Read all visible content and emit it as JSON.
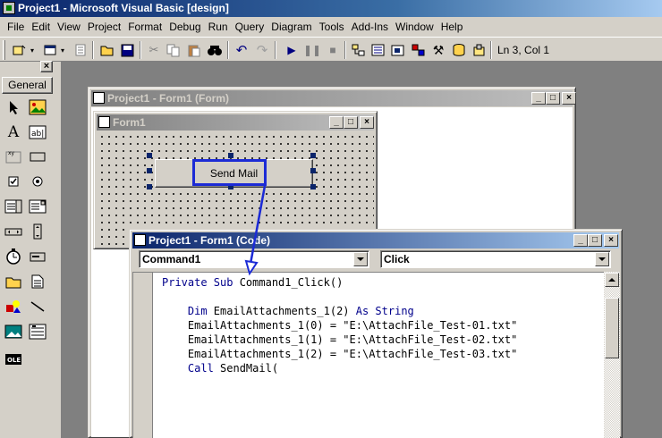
{
  "app": {
    "title": "Project1 - Microsoft Visual Basic [design]"
  },
  "menu": [
    {
      "label": "File"
    },
    {
      "label": "Edit"
    },
    {
      "label": "View"
    },
    {
      "label": "Project"
    },
    {
      "label": "Format"
    },
    {
      "label": "Debug"
    },
    {
      "label": "Run"
    },
    {
      "label": "Query"
    },
    {
      "label": "Diagram"
    },
    {
      "label": "Tools"
    },
    {
      "label": "Add-Ins"
    },
    {
      "label": "Window"
    },
    {
      "label": "Help"
    }
  ],
  "toolbar": {
    "cursor_position": "Ln 3, Col 1"
  },
  "toolbox": {
    "tab_label": "General",
    "close_label": "×"
  },
  "windows": {
    "form_designer_title": "Project1 - Form1 (Form)",
    "form_title": "Form1",
    "code_title": "Project1 - Form1 (Code)"
  },
  "form": {
    "button_caption": "Send Mail"
  },
  "code": {
    "object_combo": "Command1",
    "procedure_combo": "Click",
    "lines": [
      {
        "kw": "Private Sub",
        "text": " Command1_Click()"
      },
      {
        "kw": "",
        "text": ""
      },
      {
        "kw": "    Dim",
        "text": " EmailAttachments_1(2) ",
        "kw2": "As String"
      },
      {
        "kw": "",
        "text": "    EmailAttachments_1(0) = \"E:\\AttachFile_Test-01.txt\""
      },
      {
        "kw": "",
        "text": "    EmailAttachments_1(1) = \"E:\\AttachFile_Test-02.txt\""
      },
      {
        "kw": "",
        "text": "    EmailAttachments_1(2) = \"E:\\AttachFile_Test-03.txt\""
      },
      {
        "kw": "    Call",
        "text": " SendMail("
      }
    ]
  },
  "colors": {
    "active_title": "#0a246a",
    "highlight": "#1c2bd6",
    "keyword": "#00008b"
  }
}
